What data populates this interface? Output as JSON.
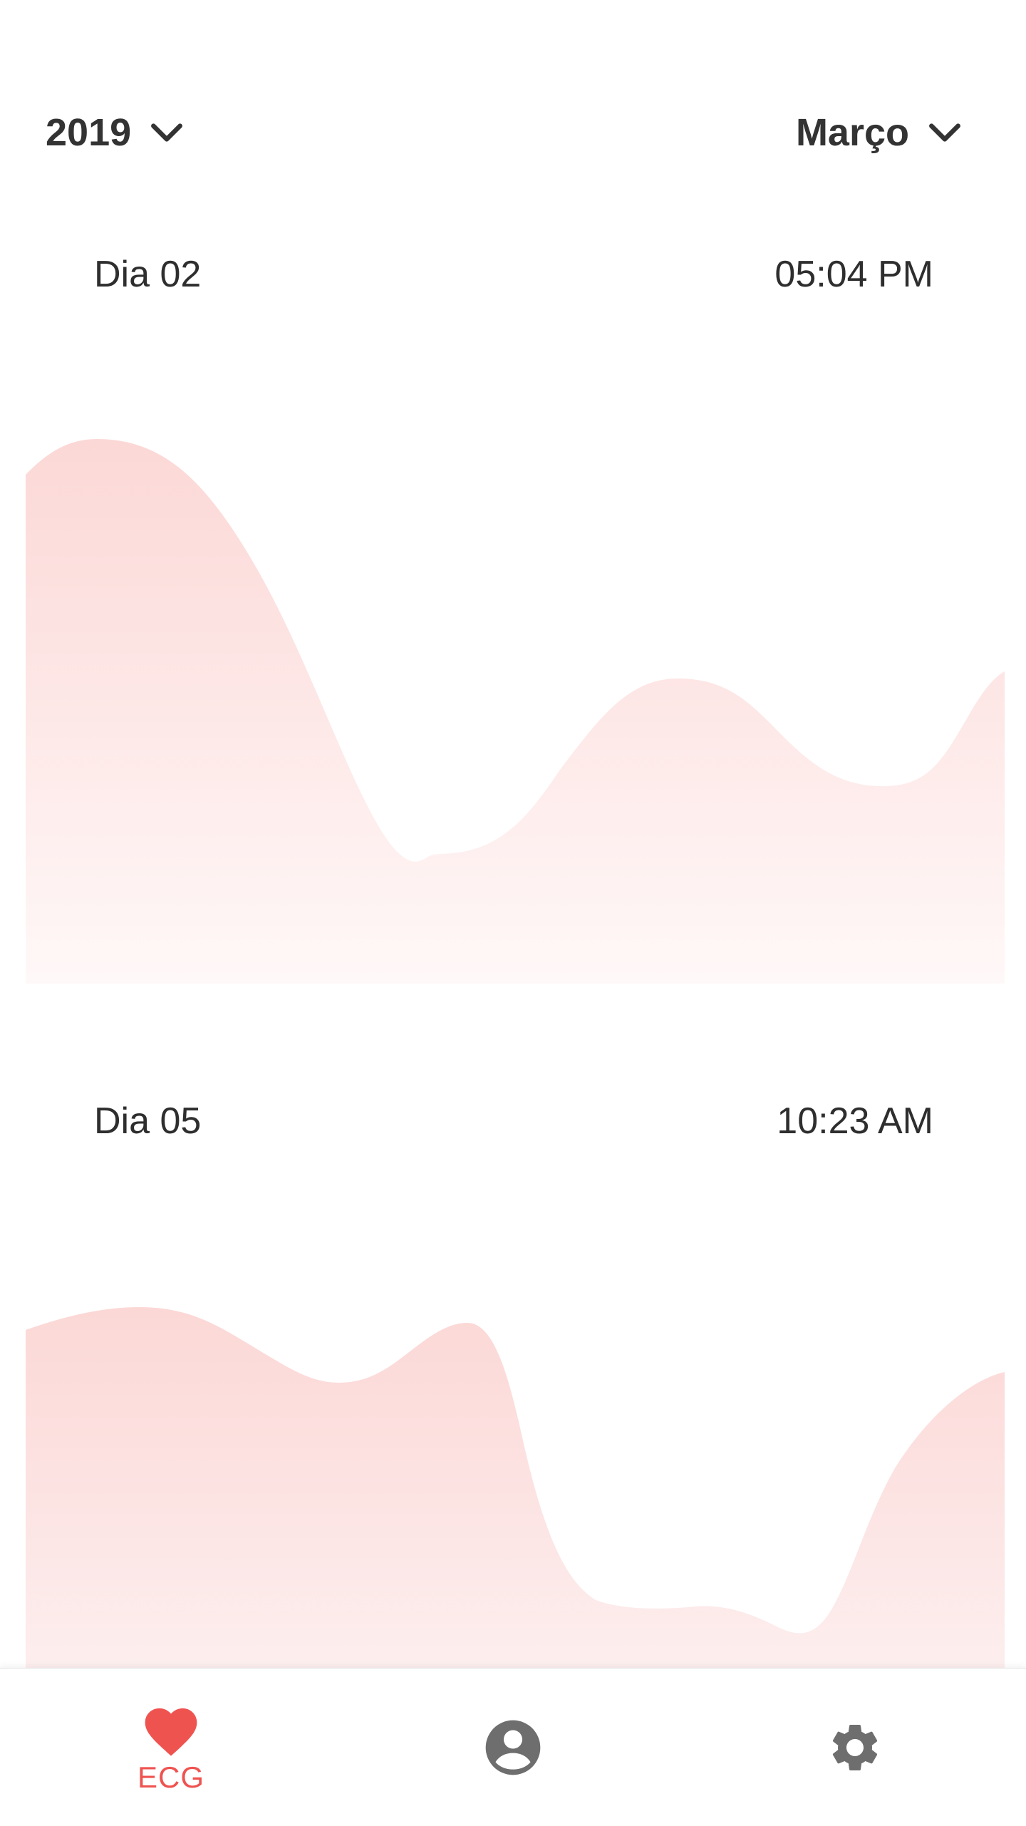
{
  "header": {
    "year": "2019",
    "month": "Março"
  },
  "records": [
    {
      "day": "Dia 02",
      "time": "05:04 PM"
    },
    {
      "day": "Dia 05",
      "time": "10:23 AM"
    }
  ],
  "bottom_nav": {
    "items": [
      {
        "label": "ECG",
        "icon": "heart-icon",
        "active": true
      },
      {
        "label": "",
        "icon": "account-circle-icon",
        "active": false
      },
      {
        "label": "",
        "icon": "gear-icon",
        "active": false
      }
    ]
  },
  "colors": {
    "accent": "#ef5350",
    "chart_fill_top": "#fbd8d6",
    "chart_fill_bottom": "#fff7f7",
    "inactive_icon": "#6e6e6e",
    "text": "#333333"
  }
}
